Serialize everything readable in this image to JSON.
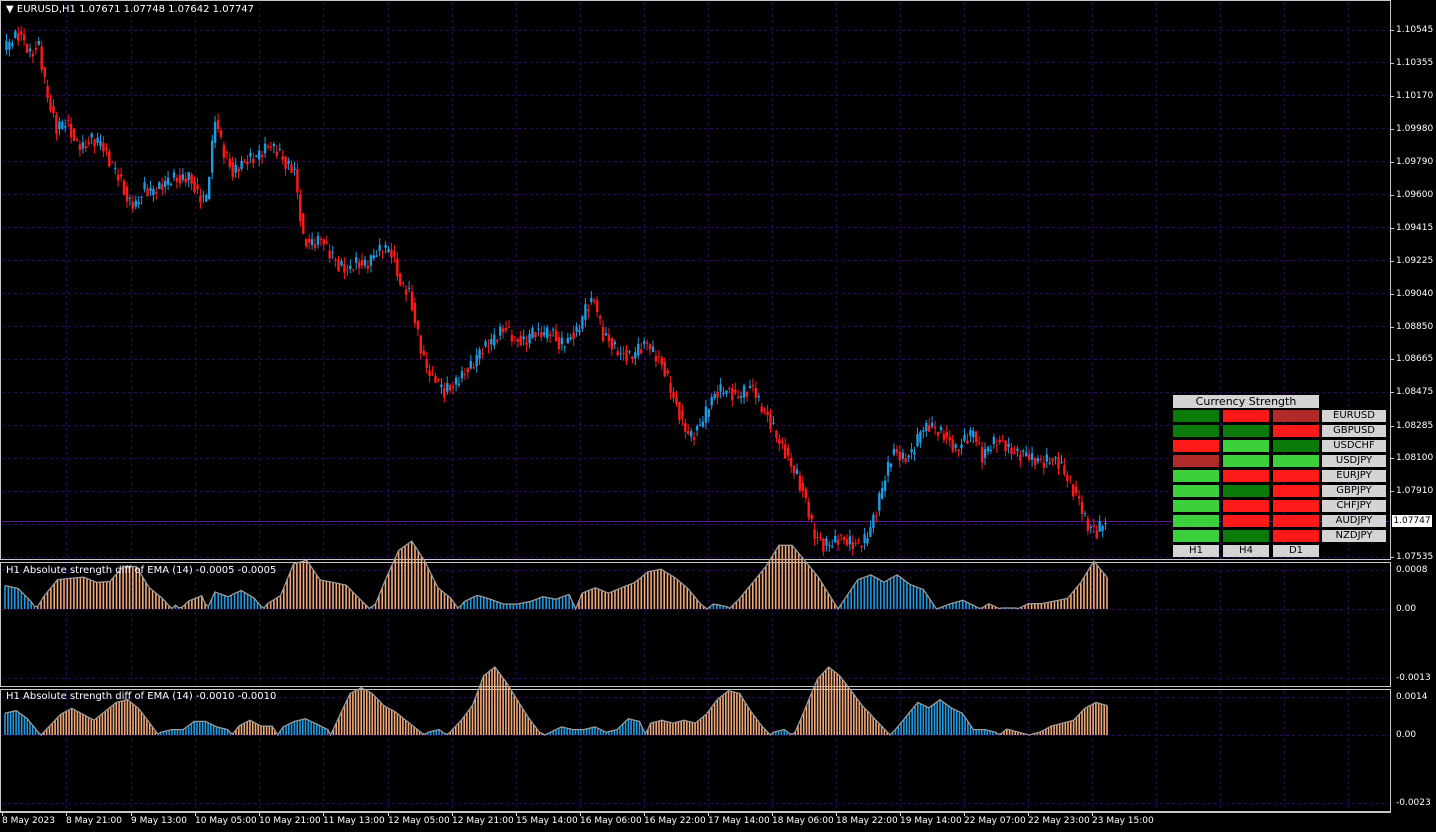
{
  "colors": {
    "background": "#000000",
    "grid": "#2a0a55",
    "bull": "#1e9be0",
    "bear": "#ff1a1a",
    "hist_pos": "#1e9be0",
    "hist_neg": "#f2a97a",
    "osc_line": "#9a9a9a",
    "cs_light_green": "#3cd03c",
    "cs_dark_green": "#0a7a0a",
    "cs_red": "#ff1a1a",
    "cs_dark_red": "#b02a2a"
  },
  "main": {
    "header": "EURUSD,H1  1.07671 1.07748 1.07642 1.07747",
    "current_price": "1.07747",
    "price_levels": [
      "1.10545",
      "1.10355",
      "1.10170",
      "1.09980",
      "1.09790",
      "1.09600",
      "1.09415",
      "1.09225",
      "1.09040",
      "1.08850",
      "1.08665",
      "1.08475",
      "1.08285",
      "1.08100",
      "1.07910",
      "1.07747",
      "1.07535"
    ],
    "price_series": [
      1.1043,
      1.105,
      1.1052,
      1.1041,
      1.1045,
      1.1015,
      1.0998,
      1.1003,
      1.0992,
      1.0988,
      1.0992,
      1.099,
      1.0979,
      1.0972,
      1.0958,
      1.0955,
      1.0964,
      1.0962,
      1.0965,
      1.097,
      1.0969,
      1.0972,
      1.096,
      1.0958,
      1.1003,
      1.0985,
      1.0973,
      1.0979,
      1.0981,
      1.0983,
      1.0988,
      1.0986,
      1.0978,
      1.0975,
      1.0935,
      1.0932,
      1.0935,
      1.0927,
      1.092,
      1.0918,
      1.0922,
      1.092,
      1.0925,
      1.093,
      1.0928,
      1.091,
      1.0905,
      1.088,
      1.086,
      1.0855,
      1.0848,
      1.0852,
      1.0858,
      1.0862,
      1.087,
      1.0875,
      1.088,
      1.0885,
      1.0878,
      1.0876,
      1.0882,
      1.088,
      1.0883,
      1.0875,
      1.0878,
      1.0882,
      1.0895,
      1.09,
      1.088,
      1.0875,
      1.087,
      1.0868,
      1.0872,
      1.0875,
      1.0868,
      1.086,
      1.0845,
      1.083,
      1.0822,
      1.0828,
      1.084,
      1.0848,
      1.085,
      1.0845,
      1.0848,
      1.085,
      1.0838,
      1.083,
      1.082,
      1.081,
      1.08,
      1.0785,
      1.0765,
      1.076,
      1.0762,
      1.0765,
      1.0762,
      1.076,
      1.0765,
      1.078,
      1.08,
      1.0815,
      1.081,
      1.0812,
      1.0825,
      1.0828,
      1.0826,
      1.0822,
      1.0815,
      1.082,
      1.0825,
      1.081,
      1.0818,
      1.082,
      1.0816,
      1.0812,
      1.0812,
      1.0808,
      1.0808,
      1.081,
      1.0806,
      1.0795,
      1.0785,
      1.077,
      1.0768,
      1.0775
    ]
  },
  "osc1": {
    "title": "H1 Absolute strength diff of EMA (14) -0.0005 -0.0005",
    "levels": [
      "0.0008",
      "0.00",
      "-0.0013"
    ],
    "series": [
      0.00048,
      0.00042,
      0.00015,
      -0.00025,
      -0.00055,
      -0.00058,
      -0.0006,
      -0.0005,
      -0.00052,
      -0.0008,
      -0.0008,
      -0.0004,
      -0.0002,
      8e-05,
      -0.00015,
      -0.00025,
      0.00035,
      0.00025,
      0.00038,
      0.00022,
      -0.0001,
      -0.00025,
      -0.00085,
      -0.00092,
      -0.00055,
      -0.0005,
      -0.00045,
      -0.0002,
      5e-05,
      -0.00055,
      -0.0011,
      -0.00128,
      -0.0009,
      -0.0004,
      -0.0002,
      0.00015,
      0.00028,
      0.0002,
      0.0001,
      0.0001,
      0.00015,
      0.00025,
      0.0002,
      0.0003,
      -0.0003,
      -0.0004,
      -0.0003,
      -0.0004,
      -0.0005,
      -0.0007,
      -0.00075,
      -0.0006,
      -0.0004,
      -0.0001,
      0.0001,
      5e-05,
      -0.0002,
      -0.0005,
      -0.0008,
      -0.0012,
      -0.0012,
      -0.0009,
      -0.0006,
      -0.0002,
      0.0002,
      0.0006,
      0.0007,
      0.00055,
      0.0007,
      0.0005,
      0.0004,
      0.0,
      0.0001,
      0.00018,
      5e-05,
      -0.0001,
      2e-05,
      2e-05,
      -0.0001,
      -0.0001,
      -0.00015,
      -0.0002,
      -0.0005,
      -0.0009,
      -0.0006
    ]
  },
  "osc2": {
    "title": "H1 Absolute strength diff of EMA (14) -0.0010 -0.0010",
    "levels": [
      "0.0014",
      "0.00",
      "-0.0023"
    ],
    "series": [
      0.0008,
      0.0009,
      0.0006,
      0.0001,
      -0.0003,
      -0.0007,
      -0.0009,
      -0.0007,
      -0.0005,
      -0.0008,
      -0.0011,
      -0.0012,
      -0.0009,
      -0.0004,
      0.0001,
      0.0002,
      0.0002,
      0.0005,
      0.0005,
      0.0003,
      0.0002,
      -0.0003,
      -0.0005,
      -0.0003,
      -0.0003,
      0.0003,
      0.0005,
      0.0006,
      0.0004,
      0.0002,
      -0.0006,
      -0.0014,
      -0.0016,
      -0.0014,
      -0.001,
      -0.0008,
      -0.0005,
      -0.0002,
      0.0001,
      0.0002,
      -0.0001,
      -0.0005,
      -0.001,
      -0.002,
      -0.0023,
      -0.0018,
      -0.0012,
      -0.0006,
      -0.0001,
      0.0001,
      0.0003,
      0.0002,
      0.0002,
      0.0003,
      0.0001,
      0.0002,
      0.0006,
      0.0005,
      -0.0004,
      -0.0005,
      -0.0004,
      -0.0005,
      -0.0004,
      -0.0007,
      -0.0012,
      -0.0015,
      -0.0014,
      -0.0008,
      -0.0003,
      0.0001,
      0.0002,
      -0.0001,
      -0.001,
      -0.0019,
      -0.0023,
      -0.002,
      -0.0015,
      -0.001,
      -0.0006,
      -0.0002,
      0.0002,
      0.0007,
      0.0012,
      0.001,
      0.0013,
      0.001,
      0.0008,
      0.0002,
      0.0002,
      0.0001,
      -0.0002,
      -0.0001,
      0.0,
      -0.0001,
      -0.0003,
      -0.0004,
      -0.0005,
      -0.0009,
      -0.0011,
      -0.001
    ]
  },
  "time_labels": [
    "8 May 2023",
    "8 May 21:00",
    "9 May 13:00",
    "10 May 05:00",
    "10 May 21:00",
    "11 May 13:00",
    "12 May 05:00",
    "12 May 21:00",
    "15 May 14:00",
    "16 May 06:00",
    "16 May 22:00",
    "17 May 14:00",
    "18 May 06:00",
    "18 May 22:00",
    "19 May 14:00",
    "22 May 07:00",
    "22 May 23:00",
    "23 May 15:00"
  ],
  "currency_strength": {
    "title": "Currency Strength",
    "timeframes": [
      "H1",
      "H4",
      "D1"
    ],
    "rows": [
      {
        "pair": "EURUSD",
        "cells": [
          "dark_green",
          "red",
          "dark_red"
        ]
      },
      {
        "pair": "GBPUSD",
        "cells": [
          "dark_green",
          "dark_green",
          "red"
        ]
      },
      {
        "pair": "USDCHF",
        "cells": [
          "red",
          "light_green",
          "dark_green"
        ]
      },
      {
        "pair": "USDJPY",
        "cells": [
          "dark_red",
          "light_green",
          "light_green"
        ]
      },
      {
        "pair": "EURJPY",
        "cells": [
          "light_green",
          "red",
          "red"
        ]
      },
      {
        "pair": "GBPJPY",
        "cells": [
          "light_green",
          "dark_green",
          "red"
        ]
      },
      {
        "pair": "CHFJPY",
        "cells": [
          "light_green",
          "red",
          "red"
        ]
      },
      {
        "pair": "AUDJPY",
        "cells": [
          "light_green",
          "red",
          "red"
        ]
      },
      {
        "pair": "NZDJPY",
        "cells": [
          "light_green",
          "dark_green",
          "red"
        ]
      }
    ]
  }
}
